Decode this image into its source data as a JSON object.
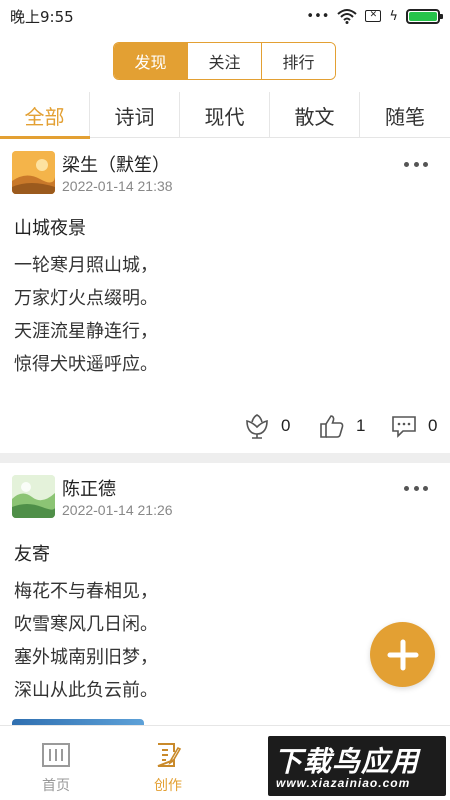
{
  "status_bar": {
    "time": "晚上9:55",
    "dots": "•••",
    "sim": "✕",
    "charge": "ϟ"
  },
  "segment": {
    "items": [
      "发现",
      "关注",
      "排行"
    ],
    "active": 0
  },
  "tabs": {
    "items": [
      "全部",
      "诗词",
      "现代",
      "散文",
      "随笔"
    ],
    "active": 0
  },
  "posts": [
    {
      "author": "梁生（默笙）",
      "date": "2022-01-14 21:38",
      "title": "山城夜景",
      "lines": [
        "一轮寒月照山城，",
        "万家灯火点缀明。",
        "天涯流星静连行，",
        "惊得犬吠遥呼应。"
      ],
      "flowers": "0",
      "likes": "1",
      "comments": "0"
    },
    {
      "author": "陈正德",
      "date": "2022-01-14 21:26",
      "title": "友寄",
      "lines": [
        "梅花不与春相见，",
        "吹雪寒风几日闲。",
        "塞外城南别旧梦，",
        "深山从此负云前。"
      ]
    }
  ],
  "bottom_nav": {
    "items": [
      "首页",
      "创作"
    ],
    "active": 1
  },
  "watermark": {
    "main": "下载鸟应用",
    "sub": "www.xiazainiao.com"
  },
  "colors": {
    "accent": "#e3a033",
    "battery": "#26c34a"
  }
}
